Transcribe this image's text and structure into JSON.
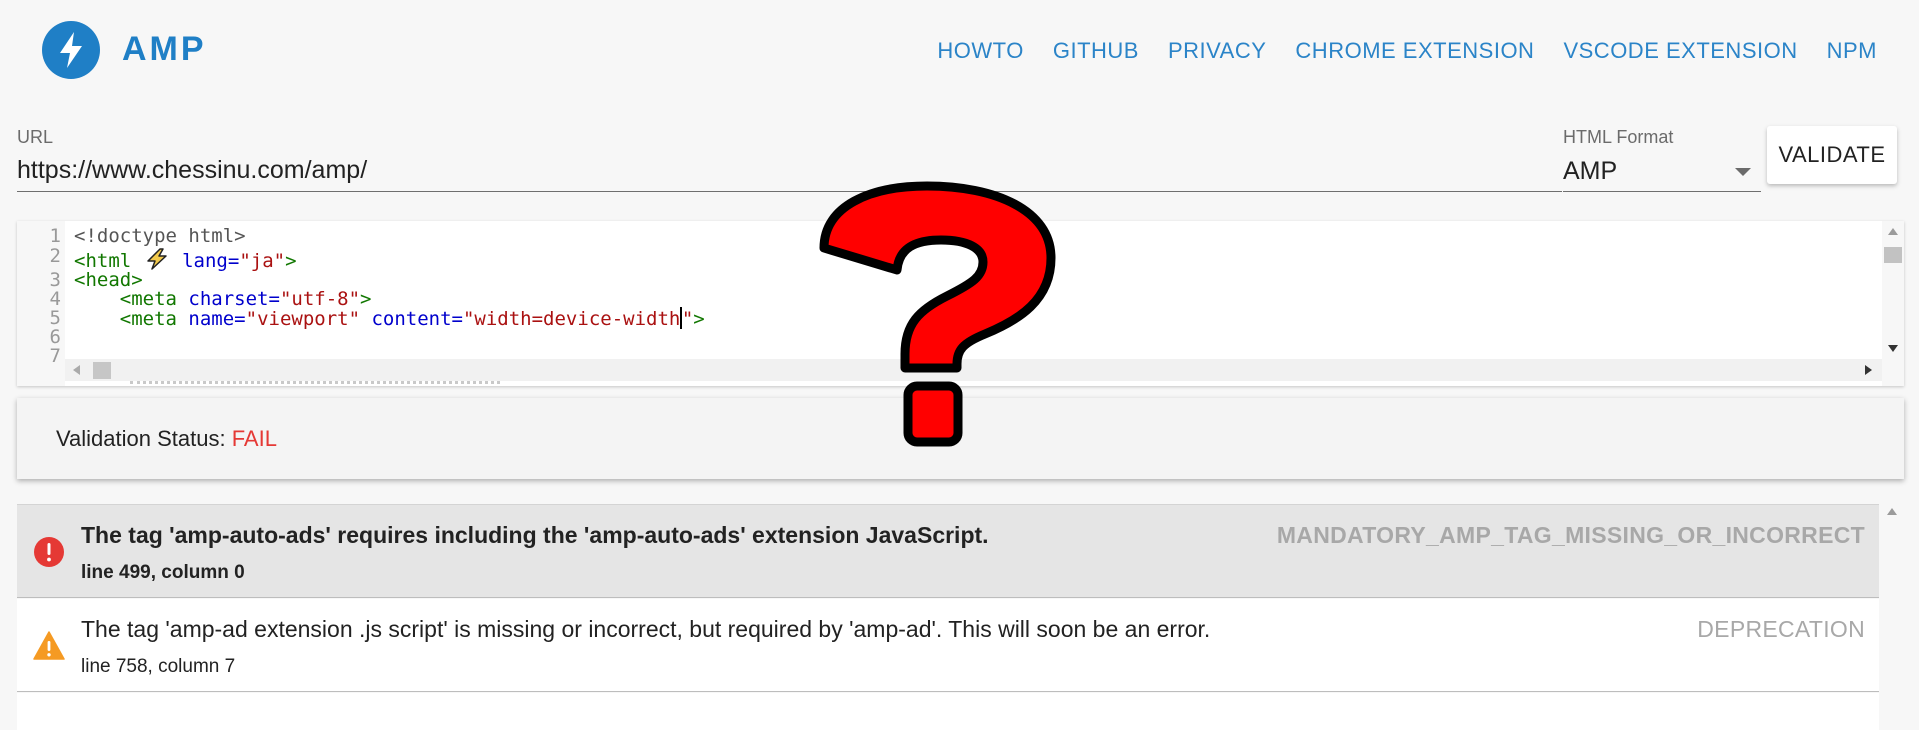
{
  "brand": {
    "name": "AMP",
    "logo_icon": "lightning-bolt-icon",
    "color": "#1f7fc6"
  },
  "nav": {
    "links": [
      "HOWTO",
      "GITHUB",
      "PRIVACY",
      "CHROME EXTENSION",
      "VSCODE EXTENSION",
      "NPM"
    ]
  },
  "form": {
    "url_label": "URL",
    "url_value": "https://www.chessinu.com/amp/",
    "format_label": "HTML Format",
    "format_value": "AMP",
    "validate_label": "VALIDATE"
  },
  "editor": {
    "line_numbers": [
      "1",
      "2",
      "3",
      "4",
      "5",
      "6",
      "7"
    ],
    "lines": {
      "l1": "<!doctype html>",
      "l2_open": "<html",
      "l2_attr": "lang=",
      "l2_val": "\"ja\"",
      "l2_close": ">",
      "l3": "<head>",
      "l4_open": "<meta",
      "l4_attr": "charset=",
      "l4_val": "\"utf-8\"",
      "l4_close": ">",
      "l5_open": "<meta",
      "l5_attr1": "name=",
      "l5_val1": "\"viewport\"",
      "l5_attr2": "content=",
      "l5_val2": "\"width=device-width",
      "l5_val2_end": "\"",
      "l5_close": ">"
    }
  },
  "status": {
    "label": "Validation Status: ",
    "value": "FAIL",
    "color": "#e53935"
  },
  "errors": [
    {
      "severity": "error",
      "icon": "error-circle-icon",
      "message": "The tag 'amp-auto-ads' requires including the 'amp-auto-ads' extension JavaScript.",
      "location": "line 499, column 0",
      "code": "MANDATORY_AMP_TAG_MISSING_OR_INCORRECT"
    },
    {
      "severity": "warning",
      "icon": "warning-triangle-icon",
      "message": "The tag 'amp-ad extension .js script' is missing or incorrect, but required by 'amp-ad'. This will soon be an error.",
      "location": "line 758, column 7",
      "code": "DEPRECATION"
    }
  ],
  "overlay": {
    "icon": "question-mark-icon",
    "color": "#ff0000"
  }
}
